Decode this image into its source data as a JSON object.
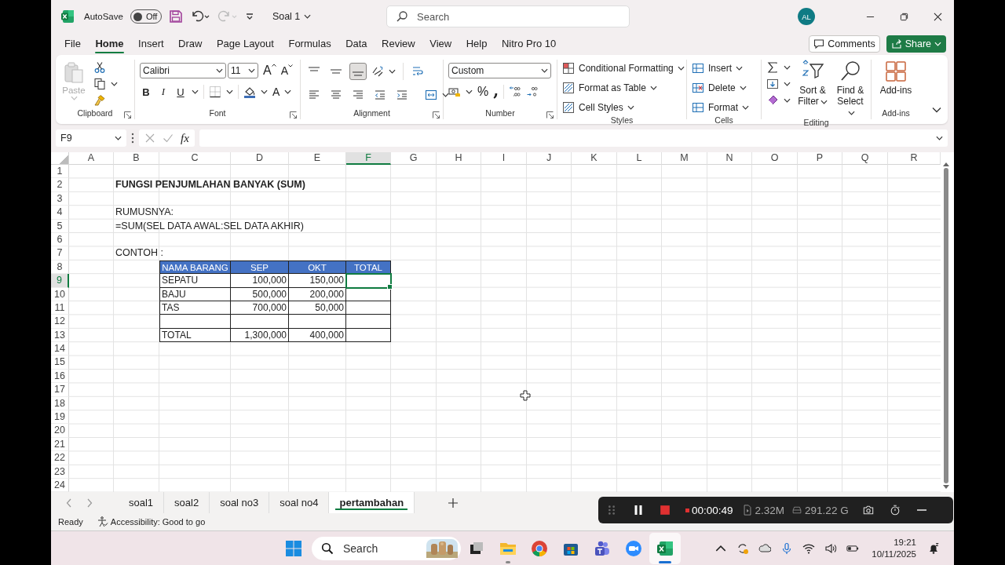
{
  "title_bar": {
    "autosave": "AutoSave",
    "autosave_toggle": {
      "label": "Off",
      "on": false
    },
    "redo_disabled": true,
    "document": "Soal 1",
    "search": {
      "placeholder": "Search"
    },
    "avatar": "AL"
  },
  "menu_tabs": [
    {
      "label": "File",
      "selected": false
    },
    {
      "label": "Home",
      "selected": true
    },
    {
      "label": "Insert",
      "selected": false
    },
    {
      "label": "Draw",
      "selected": false
    },
    {
      "label": "Page Layout",
      "selected": false
    },
    {
      "label": "Formulas",
      "selected": false
    },
    {
      "label": "Data",
      "selected": false
    },
    {
      "label": "Review",
      "selected": false
    },
    {
      "label": "View",
      "selected": false
    },
    {
      "label": "Help",
      "selected": false
    },
    {
      "label": "Nitro Pro 10",
      "selected": false
    }
  ],
  "comments": "Comments",
  "share": "Share",
  "ribbon": {
    "clipboard": {
      "label": "Clipboard",
      "paste": {
        "label": "Paste",
        "disabled": true
      }
    },
    "font": {
      "label": "Font",
      "family": "Calibri",
      "size": "11",
      "grow": "A",
      "shrink": "A",
      "bold": "B",
      "italic": "I",
      "underline": "U",
      "font_color": "A"
    },
    "alignment": {
      "label": "Alignment",
      "vertical": [
        {
          "selected": false
        },
        {
          "selected": false
        },
        {
          "selected": true
        }
      ]
    },
    "number": {
      "label": "Number",
      "format": "Custom",
      "percent": "%",
      "comma": ","
    },
    "styles": {
      "label": "Styles",
      "items": [
        "Conditional Formatting",
        "Format as Table",
        "Cell Styles"
      ]
    },
    "cells": {
      "label": "Cells",
      "items": [
        "Insert",
        "Delete",
        "Format"
      ]
    },
    "editing": {
      "label": "Editing",
      "sort": "Sort & Filter",
      "find": "Find & Select"
    },
    "addins": {
      "label": "Add-ins",
      "button": "Add-ins"
    }
  },
  "formula_bar": {
    "name_box": "F9",
    "fx": "fx"
  },
  "sheet": {
    "columns": [
      {
        "label": "A",
        "selected": false
      },
      {
        "label": "B",
        "selected": false
      },
      {
        "label": "C",
        "selected": false
      },
      {
        "label": "D",
        "selected": false
      },
      {
        "label": "E",
        "selected": false
      },
      {
        "label": "F",
        "selected": true
      },
      {
        "label": "G",
        "selected": false
      },
      {
        "label": "H",
        "selected": false
      },
      {
        "label": "I",
        "selected": false
      },
      {
        "label": "J",
        "selected": false
      },
      {
        "label": "K",
        "selected": false
      },
      {
        "label": "L",
        "selected": false
      },
      {
        "label": "M",
        "selected": false
      },
      {
        "label": "N",
        "selected": false
      },
      {
        "label": "O",
        "selected": false
      },
      {
        "label": "P",
        "selected": false
      },
      {
        "label": "Q",
        "selected": false
      },
      {
        "label": "R",
        "selected": false
      }
    ],
    "rows": [
      {
        "label": "1",
        "selected": false,
        "kind": "blank"
      },
      {
        "label": "2",
        "selected": false,
        "kind": "title",
        "note": "FUNGSI PENJUMLAHAN BANYAK (SUM)"
      },
      {
        "label": "3",
        "selected": false,
        "kind": "blank"
      },
      {
        "label": "4",
        "selected": false,
        "kind": "note",
        "note": "RUMUSNYA:"
      },
      {
        "label": "5",
        "selected": false,
        "kind": "note",
        "note": "=SUM(SEL DATA AWAL:SEL DATA AKHIR)"
      },
      {
        "label": "6",
        "selected": false,
        "kind": "blank"
      },
      {
        "label": "7",
        "selected": false,
        "kind": "note",
        "note": "CONTOH :"
      },
      {
        "label": "8",
        "selected": false,
        "kind": "table-head",
        "cells": [
          "NAMA BARANG",
          "SEP",
          "OKT",
          "TOTAL"
        ]
      },
      {
        "label": "9",
        "selected": true,
        "kind": "table-body",
        "cells": [
          "SEPATU",
          "100,000",
          "150,000"
        ]
      },
      {
        "label": "10",
        "selected": false,
        "kind": "table-body",
        "cells": [
          "BAJU",
          "500,000",
          "200,000"
        ]
      },
      {
        "label": "11",
        "selected": false,
        "kind": "table-body",
        "cells": [
          "TAS",
          "700,000",
          "50,000"
        ]
      },
      {
        "label": "12",
        "selected": false,
        "kind": "table-body"
      },
      {
        "label": "13",
        "selected": false,
        "kind": "table-body",
        "cells": [
          "TOTAL",
          "1,300,000",
          "400,000"
        ]
      },
      {
        "label": "14",
        "selected": false,
        "kind": "blank"
      },
      {
        "label": "15",
        "selected": false,
        "kind": "blank"
      },
      {
        "label": "16",
        "selected": false,
        "kind": "blank"
      },
      {
        "label": "17",
        "selected": false,
        "kind": "blank"
      },
      {
        "label": "18",
        "selected": false,
        "kind": "blank"
      },
      {
        "label": "19",
        "selected": false,
        "kind": "blank"
      },
      {
        "label": "20",
        "selected": false,
        "kind": "blank"
      },
      {
        "label": "21",
        "selected": false,
        "kind": "blank"
      },
      {
        "label": "22",
        "selected": false,
        "kind": "blank"
      },
      {
        "label": "23",
        "selected": false,
        "kind": "blank"
      },
      {
        "label": "24",
        "selected": false,
        "kind": "blank"
      }
    ]
  },
  "sheet_tabs": [
    {
      "label": "soal1",
      "selected": false
    },
    {
      "label": "soal2",
      "selected": false
    },
    {
      "label": "soal no3",
      "selected": false
    },
    {
      "label": "soal no4",
      "selected": false
    },
    {
      "label": "pertambahan",
      "selected": true
    }
  ],
  "status_bar": {
    "ready": "Ready",
    "accessibility": "Accessibility: Good to go"
  },
  "recorder": {
    "time": "00:00:49",
    "file_size": "2.32M",
    "disk": "291.22 G"
  },
  "taskbar": {
    "search": "Search",
    "apps": [
      {
        "running": false,
        "selected": false
      },
      {
        "running": true,
        "selected": false
      },
      {
        "running": false,
        "selected": false
      },
      {
        "running": false,
        "selected": false
      },
      {
        "running": false,
        "selected": false
      },
      {
        "running": false,
        "selected": false
      },
      {
        "running": true,
        "selected": true
      }
    ],
    "time": "19:21",
    "date": "10/11/2025"
  }
}
